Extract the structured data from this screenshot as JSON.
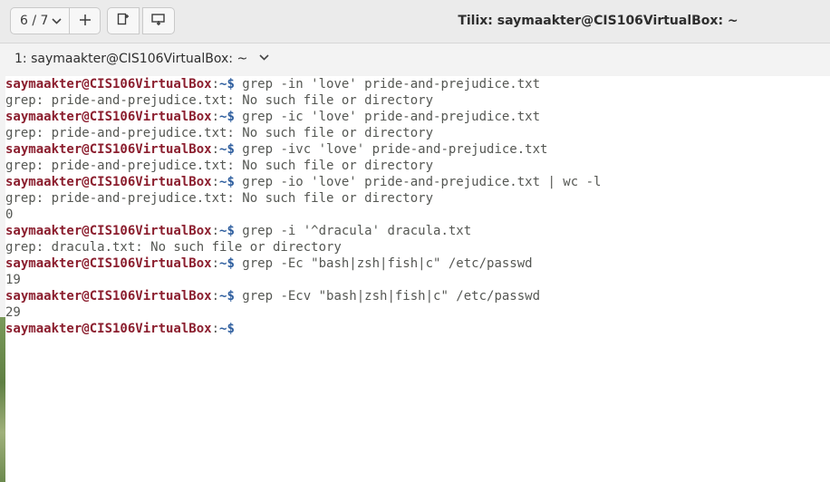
{
  "header": {
    "session_indicator": "6 / 7",
    "window_title": "Tilix: saymaakter@CIS106VirtualBox: ~"
  },
  "tabbar": {
    "terminal_title": "1: saymaakter@CIS106VirtualBox: ~"
  },
  "prompt": {
    "user_host": "saymaakter@CIS106VirtualBox",
    "colon": ":",
    "path": "~$"
  },
  "terminal_lines": [
    {
      "type": "prompt",
      "cmd": " grep -in 'love' pride-and-prejudice.txt"
    },
    {
      "type": "output",
      "text": "grep: pride-and-prejudice.txt: No such file or directory"
    },
    {
      "type": "prompt",
      "cmd": " grep -ic 'love' pride-and-prejudice.txt"
    },
    {
      "type": "output",
      "text": "grep: pride-and-prejudice.txt: No such file or directory"
    },
    {
      "type": "prompt",
      "cmd": " grep -ivc 'love' pride-and-prejudice.txt"
    },
    {
      "type": "output",
      "text": "grep: pride-and-prejudice.txt: No such file or directory"
    },
    {
      "type": "prompt",
      "cmd": " grep -io 'love' pride-and-prejudice.txt | wc -l"
    },
    {
      "type": "output",
      "text": "grep: pride-and-prejudice.txt: No such file or directory"
    },
    {
      "type": "output",
      "text": "0"
    },
    {
      "type": "prompt",
      "cmd": " grep -i '^dracula' dracula.txt"
    },
    {
      "type": "output",
      "text": "grep: dracula.txt: No such file or directory"
    },
    {
      "type": "prompt",
      "cmd": " grep -Ec \"bash|zsh|fish|c\" /etc/passwd"
    },
    {
      "type": "output",
      "text": "19"
    },
    {
      "type": "prompt",
      "cmd": " grep -Ecv \"bash|zsh|fish|c\" /etc/passwd"
    },
    {
      "type": "output",
      "text": "29"
    },
    {
      "type": "prompt",
      "cmd": ""
    }
  ]
}
